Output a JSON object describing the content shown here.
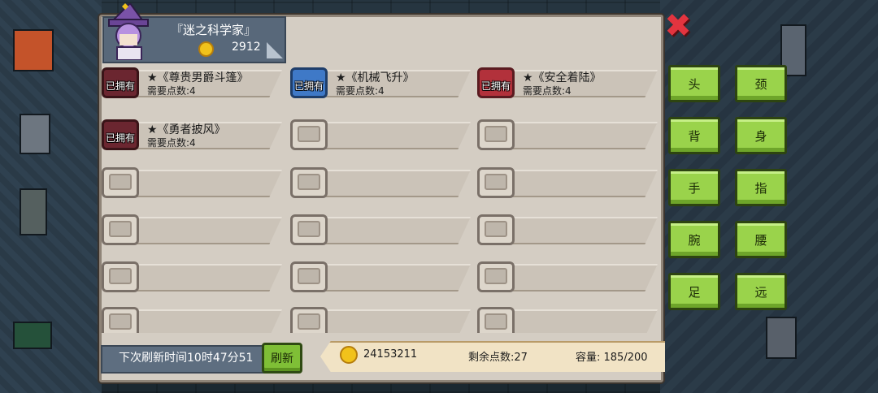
{
  "merchant": {
    "name": "『迷之科学家』",
    "gold": "2912"
  },
  "owned_label": "已拥有",
  "items": [
    {
      "name": "★《尊贵男爵斗篷》",
      "cost": "需要点数:4",
      "owned": true,
      "color": "dark"
    },
    {
      "name": "★《机械飞升》",
      "cost": "需要点数:4",
      "owned": true,
      "color": "blue"
    },
    {
      "name": "★《安全着陆》",
      "cost": "需要点数:4",
      "owned": true,
      "color": "red"
    },
    {
      "name": "★《勇者披风》",
      "cost": "需要点数:4",
      "owned": true,
      "color": "dark"
    }
  ],
  "footer": {
    "refresh_text": "下次刷新时间10时47分51",
    "refresh_button": "刷新",
    "gold": "24153211",
    "points": "剩余点数:27",
    "capacity": "容量: 185/200"
  },
  "close_icon": "✖",
  "categories": [
    "头",
    "颈",
    "背",
    "身",
    "手",
    "指",
    "腕",
    "腰",
    "足",
    "远"
  ],
  "colors": {
    "accent_green": "#9ad34b",
    "panel": "#d4cdc3",
    "close_red": "#e3343f",
    "coin": "#f1c21b"
  }
}
